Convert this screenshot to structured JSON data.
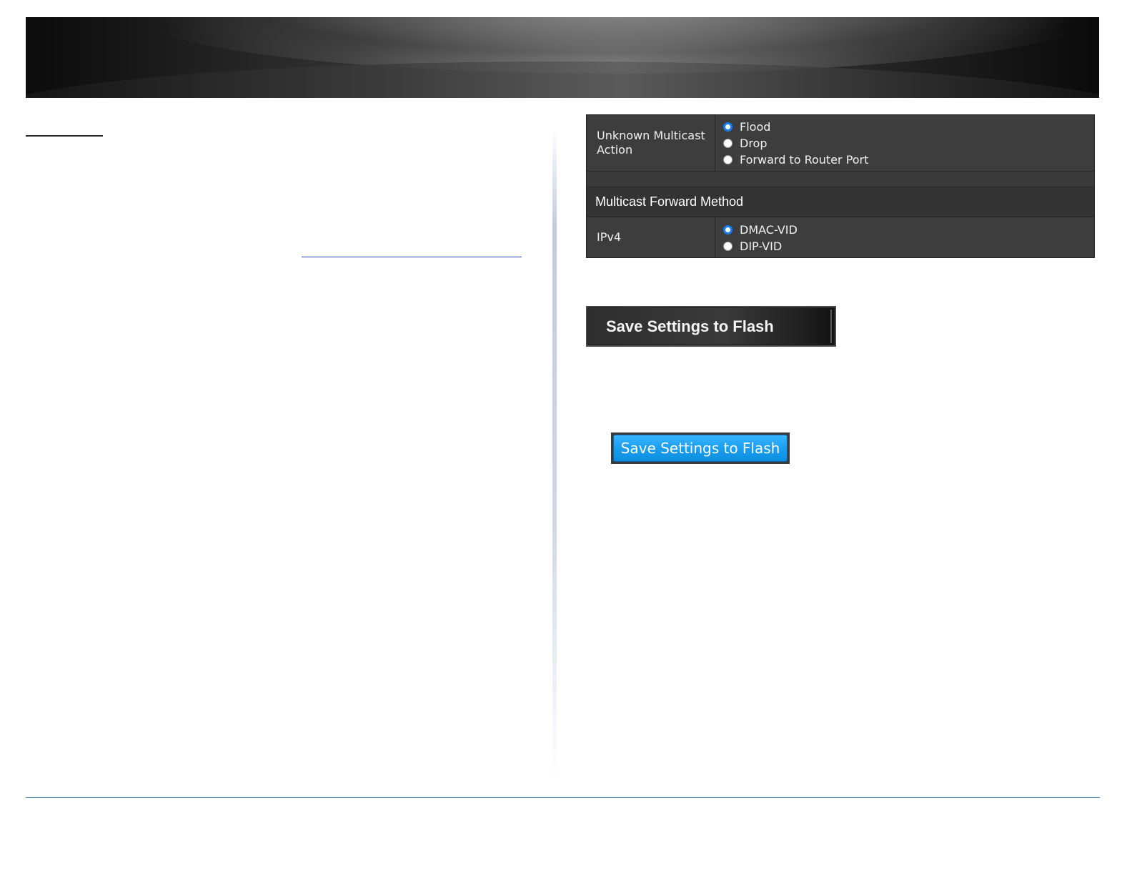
{
  "settings": {
    "unknown_multicast_action": {
      "label": "Unknown Multicast Action",
      "options": [
        {
          "label": "Flood",
          "selected": true
        },
        {
          "label": "Drop",
          "selected": false
        },
        {
          "label": "Forward to Router Port",
          "selected": false
        }
      ]
    },
    "multicast_forward_method": {
      "title": "Multicast Forward Method",
      "ipv4": {
        "label": "IPv4",
        "options": [
          {
            "label": "DMAC-VID",
            "selected": true
          },
          {
            "label": "DIP-VID",
            "selected": false
          }
        ]
      }
    }
  },
  "buttons": {
    "dark_save_label": "Save Settings to Flash",
    "blue_save_label": "Save Settings to Flash"
  },
  "colors": {
    "panel_bg": "#3d3d3d",
    "radio_selected": "#1a7cf0",
    "blue_button": "#1a9ef0",
    "footer_line": "#4b8fcf"
  }
}
